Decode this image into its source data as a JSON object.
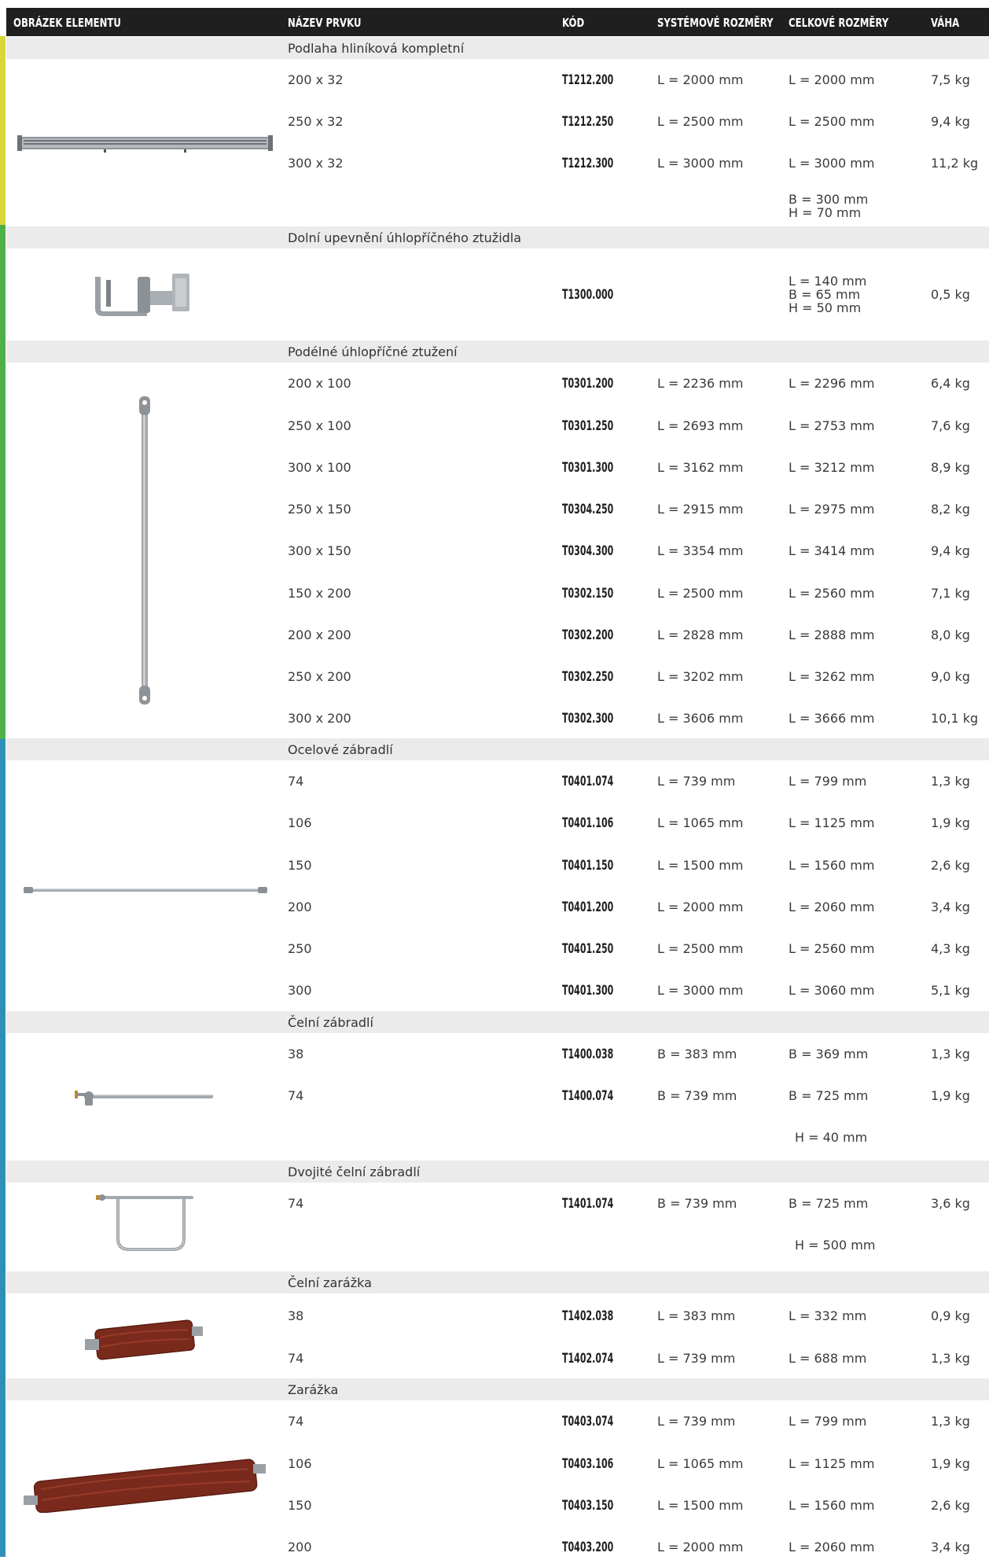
{
  "header": {
    "col_image": "OBRÁZEK ELEMENTU",
    "col_name": "NÁZEV PRVKU",
    "col_code": "KÓD",
    "col_system": "SYSTÉMOVÉ ROZMĚRY",
    "col_total": "CELKOVÉ ROZMĚRY",
    "col_weight": "VÁHA"
  },
  "colors": {
    "header_bg": "#1f1f1f",
    "band_bg": "#ebebeb",
    "stripe_yellow": "#d9d63b",
    "stripe_green": "#4fb048",
    "stripe_blue": "#2e8fb8"
  },
  "groups": [
    {
      "title": "Podlaha hliníková kompletní",
      "icon": "aluminium-deck-icon",
      "rows": [
        {
          "name": "200 x 32",
          "code": "T1212.200",
          "system": "L = 2000 mm",
          "total": "L = 2000 mm",
          "weight": "7,5 kg"
        },
        {
          "name": "250 x 32",
          "code": "T1212.250",
          "system": "L = 2500 mm",
          "total": "L = 2500 mm",
          "weight": "9,4 kg"
        },
        {
          "name": "300 x 32",
          "code": "T1212.300",
          "system": "L = 3000 mm",
          "total": "L = 3000 mm",
          "weight": "11,2 kg"
        }
      ],
      "extra": [
        "B = 300 mm",
        "H = 70 mm"
      ]
    },
    {
      "title": "Dolní upevnění úhlopříčného ztužidla",
      "icon": "diagonal-clamp-icon",
      "rows": [
        {
          "name": "",
          "code": "T1300.000",
          "system": "",
          "total_lines": [
            "L = 140 mm",
            "B = 65 mm",
            "H = 50 mm"
          ],
          "weight": "0,5 kg"
        }
      ]
    },
    {
      "title": "Podélné úhlopříčné ztužení",
      "icon": "diagonal-brace-icon",
      "rows": [
        {
          "name": "200 x 100",
          "code": "T0301.200",
          "system": "L = 2236 mm",
          "total": "L = 2296 mm",
          "weight": "6,4 kg"
        },
        {
          "name": "250 x 100",
          "code": "T0301.250",
          "system": "L = 2693 mm",
          "total": "L = 2753 mm",
          "weight": "7,6 kg"
        },
        {
          "name": "300 x 100",
          "code": "T0301.300",
          "system": "L = 3162 mm",
          "total": "L = 3212 mm",
          "weight": "8,9 kg"
        },
        {
          "name": "250 x 150",
          "code": "T0304.250",
          "system": "L = 2915 mm",
          "total": "L = 2975 mm",
          "weight": "8,2 kg"
        },
        {
          "name": "300 x 150",
          "code": "T0304.300",
          "system": "L = 3354 mm",
          "total": "L = 3414 mm",
          "weight": "9,4 kg"
        },
        {
          "name": "150 x 200",
          "code": "T0302.150",
          "system": "L = 2500 mm",
          "total": "L = 2560 mm",
          "weight": "7,1 kg"
        },
        {
          "name": "200 x 200",
          "code": "T0302.200",
          "system": "L = 2828 mm",
          "total": "L = 2888 mm",
          "weight": "8,0 kg"
        },
        {
          "name": "250 x 200",
          "code": "T0302.250",
          "system": "L = 3202 mm",
          "total": "L = 3262 mm",
          "weight": "9,0 kg"
        },
        {
          "name": "300 x 200",
          "code": "T0302.300",
          "system": "L = 3606 mm",
          "total": "L = 3666 mm",
          "weight": "10,1 kg"
        }
      ]
    },
    {
      "title": "Ocelové zábradlí",
      "icon": "steel-guardrail-icon",
      "rows": [
        {
          "name": "74",
          "code": "T0401.074",
          "system": "L = 739 mm",
          "total": "L = 799 mm",
          "weight": "1,3 kg"
        },
        {
          "name": "106",
          "code": "T0401.106",
          "system": "L = 1065 mm",
          "total": "L = 1125 mm",
          "weight": "1,9 kg"
        },
        {
          "name": "150",
          "code": "T0401.150",
          "system": "L =  1500 mm",
          "total": "L = 1560 mm",
          "weight": "2,6 kg"
        },
        {
          "name": "200",
          "code": "T0401.200",
          "system": "L = 2000 mm",
          "total": "L = 2060 mm",
          "weight": "3,4 kg"
        },
        {
          "name": "250",
          "code": "T0401.250",
          "system": "L = 2500 mm",
          "total": "L = 2560 mm",
          "weight": "4,3 kg"
        },
        {
          "name": "300",
          "code": "T0401.300",
          "system": "L = 3000 mm",
          "total": "L = 3060 mm",
          "weight": "5,1 kg"
        }
      ]
    },
    {
      "title": "Čelní zábradlí",
      "icon": "end-guardrail-icon",
      "rows": [
        {
          "name": "38",
          "code": "T1400.038",
          "system": "B = 383 mm",
          "total": "B = 369 mm",
          "weight": "1,3 kg"
        },
        {
          "name": "74",
          "code": "T1400.074",
          "system": "B = 739 mm",
          "total": "B = 725 mm",
          "weight": "1,9 kg"
        }
      ],
      "extra_line": "H = 40 mm"
    },
    {
      "title": "Dvojité čelní zábradlí",
      "icon": "double-end-guardrail-icon",
      "rows": [
        {
          "name": "74",
          "code": "T1401.074",
          "system": "B = 739 mm",
          "total": "B = 725 mm",
          "weight": "3,6 kg"
        }
      ],
      "extra_line": "H = 500 mm"
    },
    {
      "title": "Čelní zarážka",
      "icon": "end-toeboard-icon",
      "rows": [
        {
          "name": "38",
          "code": "T1402.038",
          "system": "L = 383 mm",
          "total": "L = 332 mm",
          "weight": "0,9 kg"
        },
        {
          "name": "74",
          "code": "T1402.074",
          "system": "L = 739 mm",
          "total": "L = 688 mm",
          "weight": "1,3 kg"
        }
      ]
    },
    {
      "title": "Zarážka",
      "icon": "toeboard-icon",
      "rows": [
        {
          "name": "74",
          "code": "T0403.074",
          "system": "L = 739 mm",
          "total": "L = 799 mm",
          "weight": "1,3 kg"
        },
        {
          "name": "106",
          "code": "T0403.106",
          "system": "L = 1065 mm",
          "total": "L = 1125 mm",
          "weight": "1,9 kg"
        },
        {
          "name": "150",
          "code": "T0403.150",
          "system": "L =  1500 mm",
          "total": "L = 1560 mm",
          "weight": "2,6 kg"
        },
        {
          "name": "200",
          "code": "T0403.200",
          "system": "L = 2000 mm",
          "total": "L = 2060 mm",
          "weight": "3,4 kg"
        }
      ]
    }
  ]
}
